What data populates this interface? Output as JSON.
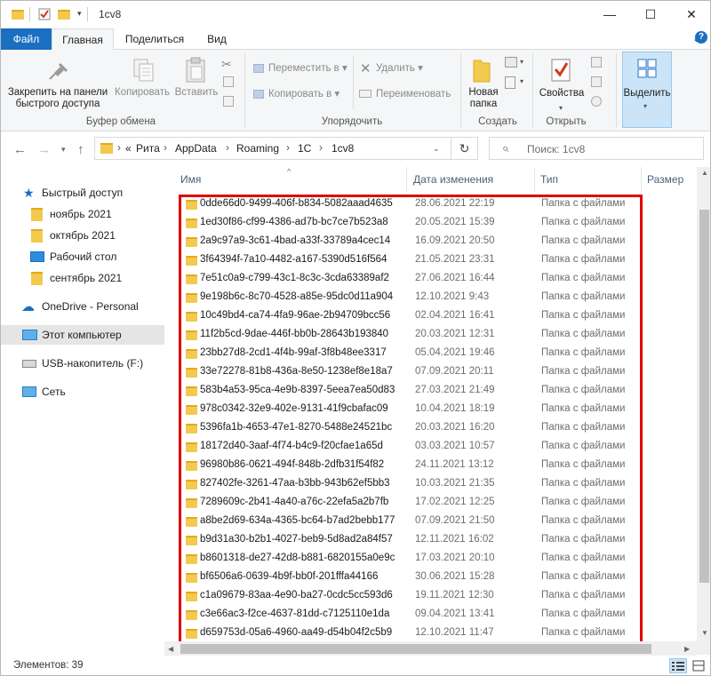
{
  "window": {
    "title": "1cv8",
    "minimize": "—",
    "maximize": "☐",
    "close": "✕"
  },
  "tabs": {
    "file": "Файл",
    "home": "Главная",
    "share": "Поделиться",
    "view": "Вид"
  },
  "ribbon": {
    "pin_line1": "Закрепить на панели",
    "pin_line2": "быстрого доступа",
    "copy": "Копировать",
    "paste": "Вставить",
    "group_clipboard": "Буфер обмена",
    "move_to": "Переместить в",
    "copy_to": "Копировать в",
    "delete": "Удалить",
    "rename": "Переименовать",
    "group_organize": "Упорядочить",
    "new_folder_line1": "Новая",
    "new_folder_line2": "папка",
    "group_create": "Создать",
    "properties": "Свойства",
    "group_open": "Открыть",
    "select": "Выделить"
  },
  "address": {
    "overflow": "«",
    "crumbs": [
      "Рита",
      "AppData",
      "Roaming",
      "1C",
      "1cv8"
    ],
    "search_placeholder": "Поиск: 1cv8"
  },
  "nav": {
    "quick_access": "Быстрый доступ",
    "items": [
      "ноябрь 2021",
      "октябрь 2021",
      "Рабочий стол",
      "сентябрь 2021"
    ],
    "onedrive": "OneDrive - Personal",
    "this_pc": "Этот компьютер",
    "usb": "USB-накопитель (F:)",
    "network": "Сеть"
  },
  "columns": {
    "name": "Имя",
    "date": "Дата изменения",
    "type": "Тип",
    "size": "Размер"
  },
  "files": [
    {
      "name": "0dde66d0-9499-406f-b834-5082aaad4635",
      "date": "28.06.2021 22:19",
      "type": "Папка с файлами"
    },
    {
      "name": "1ed30f86-cf99-4386-ad7b-bc7ce7b523a8",
      "date": "20.05.2021 15:39",
      "type": "Папка с файлами"
    },
    {
      "name": "2a9c97a9-3c61-4bad-a33f-33789a4cec14",
      "date": "16.09.2021 20:50",
      "type": "Папка с файлами"
    },
    {
      "name": "3f64394f-7a10-4482-a167-5390d516f564",
      "date": "21.05.2021 23:31",
      "type": "Папка с файлами"
    },
    {
      "name": "7e51c0a9-c799-43c1-8c3c-3cda63389af2",
      "date": "27.06.2021 16:44",
      "type": "Папка с файлами"
    },
    {
      "name": "9e198b6c-8c70-4528-a85e-95dc0d11a904",
      "date": "12.10.2021 9:43",
      "type": "Папка с файлами"
    },
    {
      "name": "10c49bd4-ca74-4fa9-96ae-2b94709bcc56",
      "date": "02.04.2021 16:41",
      "type": "Папка с файлами"
    },
    {
      "name": "11f2b5cd-9dae-446f-bb0b-28643b193840",
      "date": "20.03.2021 12:31",
      "type": "Папка с файлами"
    },
    {
      "name": "23bb27d8-2cd1-4f4b-99af-3f8b48ee3317",
      "date": "05.04.2021 19:46",
      "type": "Папка с файлами"
    },
    {
      "name": "33e72278-81b8-436a-8e50-1238ef8e18a7",
      "date": "07.09.2021 20:11",
      "type": "Папка с файлами"
    },
    {
      "name": "583b4a53-95ca-4e9b-8397-5eea7ea50d83",
      "date": "27.03.2021 21:49",
      "type": "Папка с файлами"
    },
    {
      "name": "978c0342-32e9-402e-9131-41f9cbafac09",
      "date": "10.04.2021 18:19",
      "type": "Папка с файлами"
    },
    {
      "name": "5396fa1b-4653-47e1-8270-5488e24521bc",
      "date": "20.03.2021 16:20",
      "type": "Папка с файлами"
    },
    {
      "name": "18172d40-3aaf-4f74-b4c9-f20cfae1a65d",
      "date": "03.03.2021 10:57",
      "type": "Папка с файлами"
    },
    {
      "name": "96980b86-0621-494f-848b-2dfb31f54f82",
      "date": "24.11.2021 13:12",
      "type": "Папка с файлами"
    },
    {
      "name": "827402fe-3261-47aa-b3bb-943b62ef5bb3",
      "date": "10.03.2021 21:35",
      "type": "Папка с файлами"
    },
    {
      "name": "7289609c-2b41-4a40-a76c-22efa5a2b7fb",
      "date": "17.02.2021 12:25",
      "type": "Папка с файлами"
    },
    {
      "name": "a8be2d69-634a-4365-bc64-b7ad2bebb177",
      "date": "07.09.2021 21:50",
      "type": "Папка с файлами"
    },
    {
      "name": "b9d31a30-b2b1-4027-beb9-5d8ad2a84f57",
      "date": "12.11.2021 16:02",
      "type": "Папка с файлами"
    },
    {
      "name": "b8601318-de27-42d8-b881-6820155a0e9c",
      "date": "17.03.2021 20:10",
      "type": "Папка с файлами"
    },
    {
      "name": "bf6506a6-0639-4b9f-bb0f-201fffa44166",
      "date": "30.06.2021 15:28",
      "type": "Папка с файлами"
    },
    {
      "name": "c1a09679-83aa-4e90-ba27-0cdc5cc593d6",
      "date": "19.11.2021 12:30",
      "type": "Папка с файлами"
    },
    {
      "name": "c3e66ac3-f2ce-4637-81dd-c7125110e1da",
      "date": "09.04.2021 13:41",
      "type": "Папка с файлами"
    },
    {
      "name": "d659753d-05a6-4960-aa49-d54b04f2c5b9",
      "date": "12.10.2021 11:47",
      "type": "Папка с файлами"
    }
  ],
  "status": {
    "items_count": "Элементов: 39"
  },
  "colors": {
    "accent": "#1a6fc1",
    "folder": "#f3c94f",
    "highlight_box": "#e00000"
  }
}
